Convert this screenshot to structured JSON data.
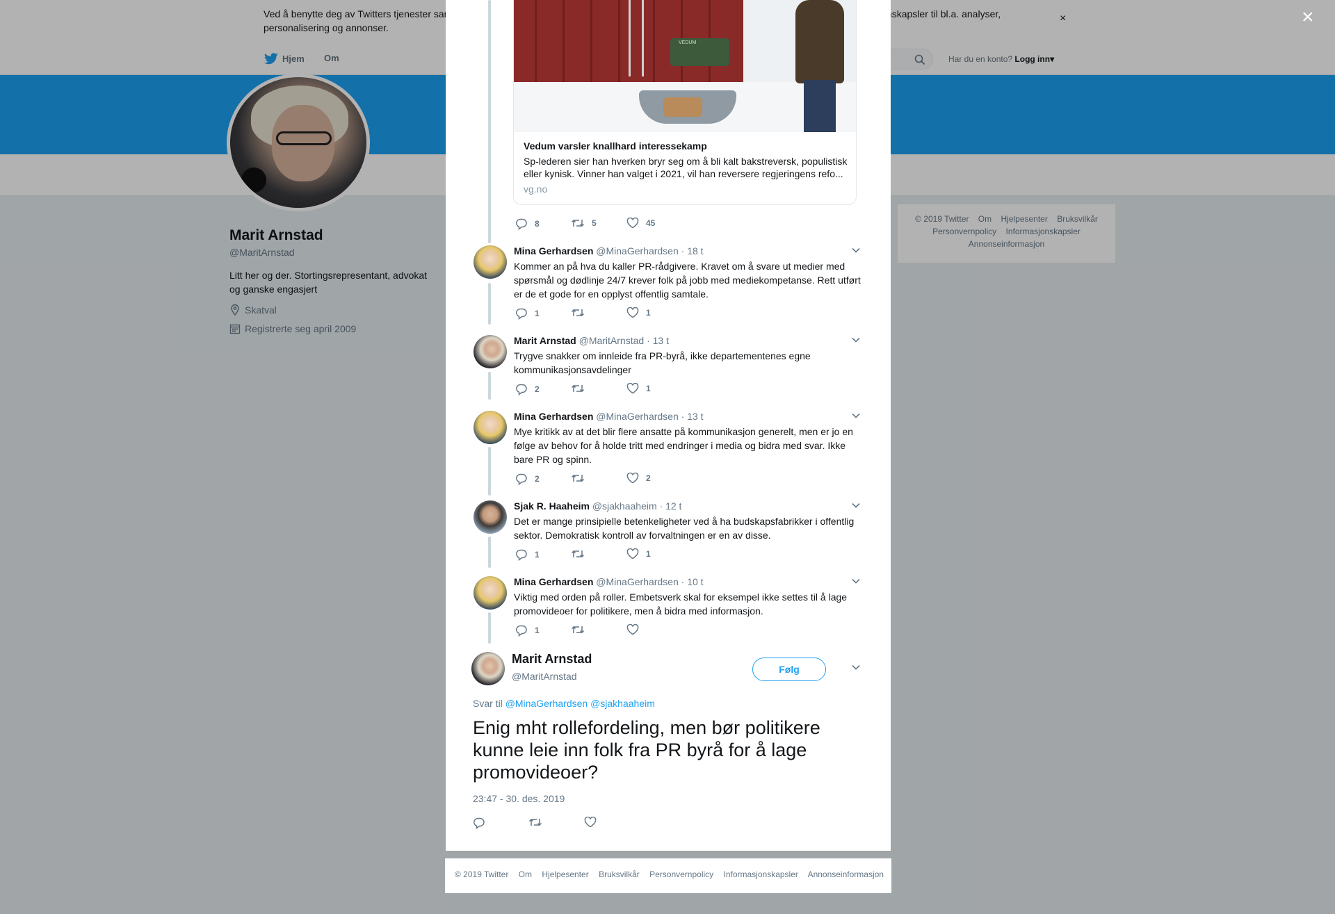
{
  "cookie_banner": {
    "text": "Ved å benytte deg av Twitters tjenester samtykker du i vår bruk av informasjonskapsler. Vi og våre partnere opererer globalt og bruker informasjonskapsler til bl.a. analyser, personalisering og annonser.",
    "close_label": "×"
  },
  "nav": {
    "home": "Hjem",
    "about": "Om",
    "account_prompt": "Har du en konto?",
    "login": "Logg inn"
  },
  "profile": {
    "name": "Marit Arnstad",
    "handle": "@MaritArnstad",
    "bio": "Litt her og der. Stortingsrepresentant, advokat og ganske engasjert",
    "location": "Skatval",
    "joined": "Registrerte seg april 2009"
  },
  "right_footer": {
    "links": [
      "© 2019 Twitter",
      "Om",
      "Hjelpesenter",
      "Bruksvilkår",
      "Personvernpolicy",
      "Informasjonskapsler",
      "Annonseinformasjon"
    ]
  },
  "modal": {
    "close_label": "×",
    "link_card": {
      "title": "Vedum varsler knallhard interessekamp",
      "description": "Sp-lederen sier han hverken bryr seg om å bli kalt bakstreversk, populistisk eller kynisk. Vinner han valget i 2021, vil han reversere regjeringens refo...",
      "domain": "vg.no",
      "image_sign_text": "VEDUM"
    },
    "parent_actions": {
      "replies": "8",
      "retweets": "5",
      "likes": "45"
    },
    "replies": [
      {
        "name": "Mina Gerhardsen",
        "handle": "@MinaGerhardsen",
        "time": "· 18 t",
        "text": "Kommer an på hva du kaller PR-rådgivere. Kravet om å svare ut medier med spørsmål og dødlinje 24/7 krever folk på jobb med mediekompetanse. Rett utført er de et gode for en opplyst offentlig samtale.",
        "replies": "1",
        "retweets": "",
        "likes": "1"
      },
      {
        "name": "Marit Arnstad",
        "handle": "@MaritArnstad",
        "time": "· 13 t",
        "text": "Trygve snakker om innleide fra PR-byrå, ikke departementenes egne kommunikasjonsavdelinger",
        "replies": "2",
        "retweets": "",
        "likes": "1"
      },
      {
        "name": "Mina Gerhardsen",
        "handle": "@MinaGerhardsen",
        "time": "· 13 t",
        "text": "Mye kritikk av at det blir flere ansatte på kommunikasjon generelt, men er jo en følge av behov for å holde tritt med endringer i media og bidra med svar. Ikke bare PR og spinn.",
        "replies": "2",
        "retweets": "",
        "likes": "2"
      },
      {
        "name": "Sjak R. Haaheim",
        "handle": "@sjakhaaheim",
        "time": "· 12 t",
        "text": "Det er mange prinsipielle betenkeligheter ved å ha budskapsfabrikker i offentlig sektor. Demokratisk kontroll av forvaltningen er en av disse.",
        "replies": "1",
        "retweets": "",
        "likes": "1"
      },
      {
        "name": "Mina Gerhardsen",
        "handle": "@MinaGerhardsen",
        "time": "· 10 t",
        "text": "Viktig med orden på roller. Embetsverk skal for eksempel ikke settes til å lage promovideoer for politikere, men å bidra med informasjon.",
        "replies": "1",
        "retweets": "",
        "likes": ""
      }
    ],
    "main_tweet": {
      "name": "Marit Arnstad",
      "handle": "@MaritArnstad",
      "follow_label": "Følg",
      "reply_to_prefix": "Svar til",
      "reply_to_1": "@MinaGerhardsen",
      "reply_to_2": "@sjakhaaheim",
      "text": "Enig mht rollefordeling, men bør politikere kunne leie inn folk fra PR byrå for å lage promovideoer?",
      "timestamp": "23:47 - 30. des. 2019"
    }
  },
  "modal_footer": {
    "links": [
      "© 2019 Twitter",
      "Om",
      "Hjelpesenter",
      "Bruksvilkår",
      "Personvernpolicy",
      "Informasjonskapsler",
      "Annonseinformasjon"
    ]
  },
  "colors": {
    "brand_blue": "#1da1f2",
    "text_primary": "#14171a",
    "text_secondary": "#657786",
    "overlay": "#a3a3a3"
  }
}
